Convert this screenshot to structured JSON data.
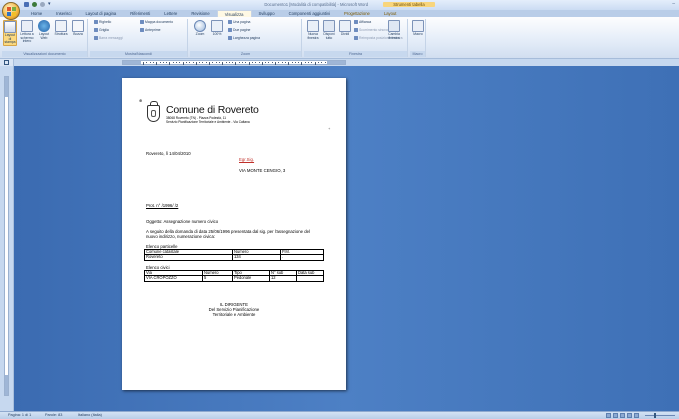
{
  "window": {
    "title": "Documento1 [Modalità di compatibilità] - Microsoft Word",
    "context_tab_group": "Strumenti tabella",
    "controls": "–"
  },
  "tabs": [
    "Home",
    "Inserisci",
    "Layout di pagina",
    "Riferimenti",
    "Lettere",
    "Revisione",
    "Visualizza",
    "Sviluppo",
    "Componenti aggiuntivi",
    "Progettazione",
    "Layout"
  ],
  "active_tab": "Visualizza",
  "ribbon": {
    "groups": {
      "views": "Visualizzazioni documento",
      "show_hide": "Mostra/Nascondi",
      "zoom": "Zoom",
      "window": "Finestra",
      "macros": "Macro"
    },
    "views": {
      "print_layout": "Layout di stampa",
      "reading": "Lettura a schermo intero",
      "web": "Layout Web",
      "outline": "Struttura",
      "draft": "Bozza"
    },
    "show_hide": {
      "ruler": "Righello",
      "gridlines": "Griglia",
      "message_bar": "Barra messaggi",
      "doc_map": "Mappa documento",
      "thumbnails": "Anteprime"
    },
    "zoom": {
      "zoom": "Zoom",
      "percent": "100%",
      "one_page": "Una pagina",
      "two_pages": "Due pagine",
      "page_width": "Larghezza pagina"
    },
    "window": {
      "new_window": "Nuova finestra",
      "arrange_all": "Disponi tutto",
      "split": "Dividi",
      "side_by_side": "Affianca",
      "sync_scroll": "Scorrimento sincrono",
      "reset_pos": "Reimposta posizione finestra",
      "switch": "Cambia finestra"
    },
    "macros": {
      "macro": "Macro"
    }
  },
  "document": {
    "corner_mark": "⊕",
    "side_mark": "+",
    "header": {
      "name": "Comune di Rovereto",
      "address1": "38068 Rovereto (TN) - Piazza Podestà, 11",
      "address2": "Servizio Pianificazione Territoriale e Ambiente - Via Caltana"
    },
    "date_line": "Rovereto, lì 14/04/2010",
    "recipient_salutation": "Egr.Sig.",
    "recipient_address": "VIA MONTE CENGIO, 3",
    "protocol": "Prot. n°   /1996/ /2",
    "subject": "Oggetto: Assegnazione numero civico",
    "body_line1": "A seguito della domanda di data 25/06/1996 presentata dal sig.   per l'assegnazione del",
    "body_line2": "nuovo indirizzo, numerazione civica:",
    "parcels_title": "Elenco particelle",
    "parcels_headers": [
      "Comune catastale",
      "Numero",
      "P.M."
    ],
    "parcels_rows": [
      [
        "Rovereto",
        "134",
        "."
      ]
    ],
    "civics_title": "Elenco civici",
    "civics_headers": [
      "Via",
      "Numero",
      "Tipo",
      "N° sub",
      "Data sub"
    ],
    "civics_rows": [
      [
        "VIA CROPOZZO",
        "5",
        "Pedonale",
        "12",
        ""
      ]
    ],
    "signature1": "IL DIRIGENTE",
    "signature2": "Del Servizio Pianificazione",
    "signature3": "Territoriale e Ambiente"
  },
  "statusbar": {
    "page": "Pagina: 1 di 1",
    "words": "Parole: 83",
    "language": "Italiano (Italia)"
  },
  "colors": {
    "ribbon_blue": "#c7d8ee",
    "workspace_blue": "#4d80c5",
    "office_orb": "#f2b43c",
    "context_tab": "#f8d57c"
  }
}
